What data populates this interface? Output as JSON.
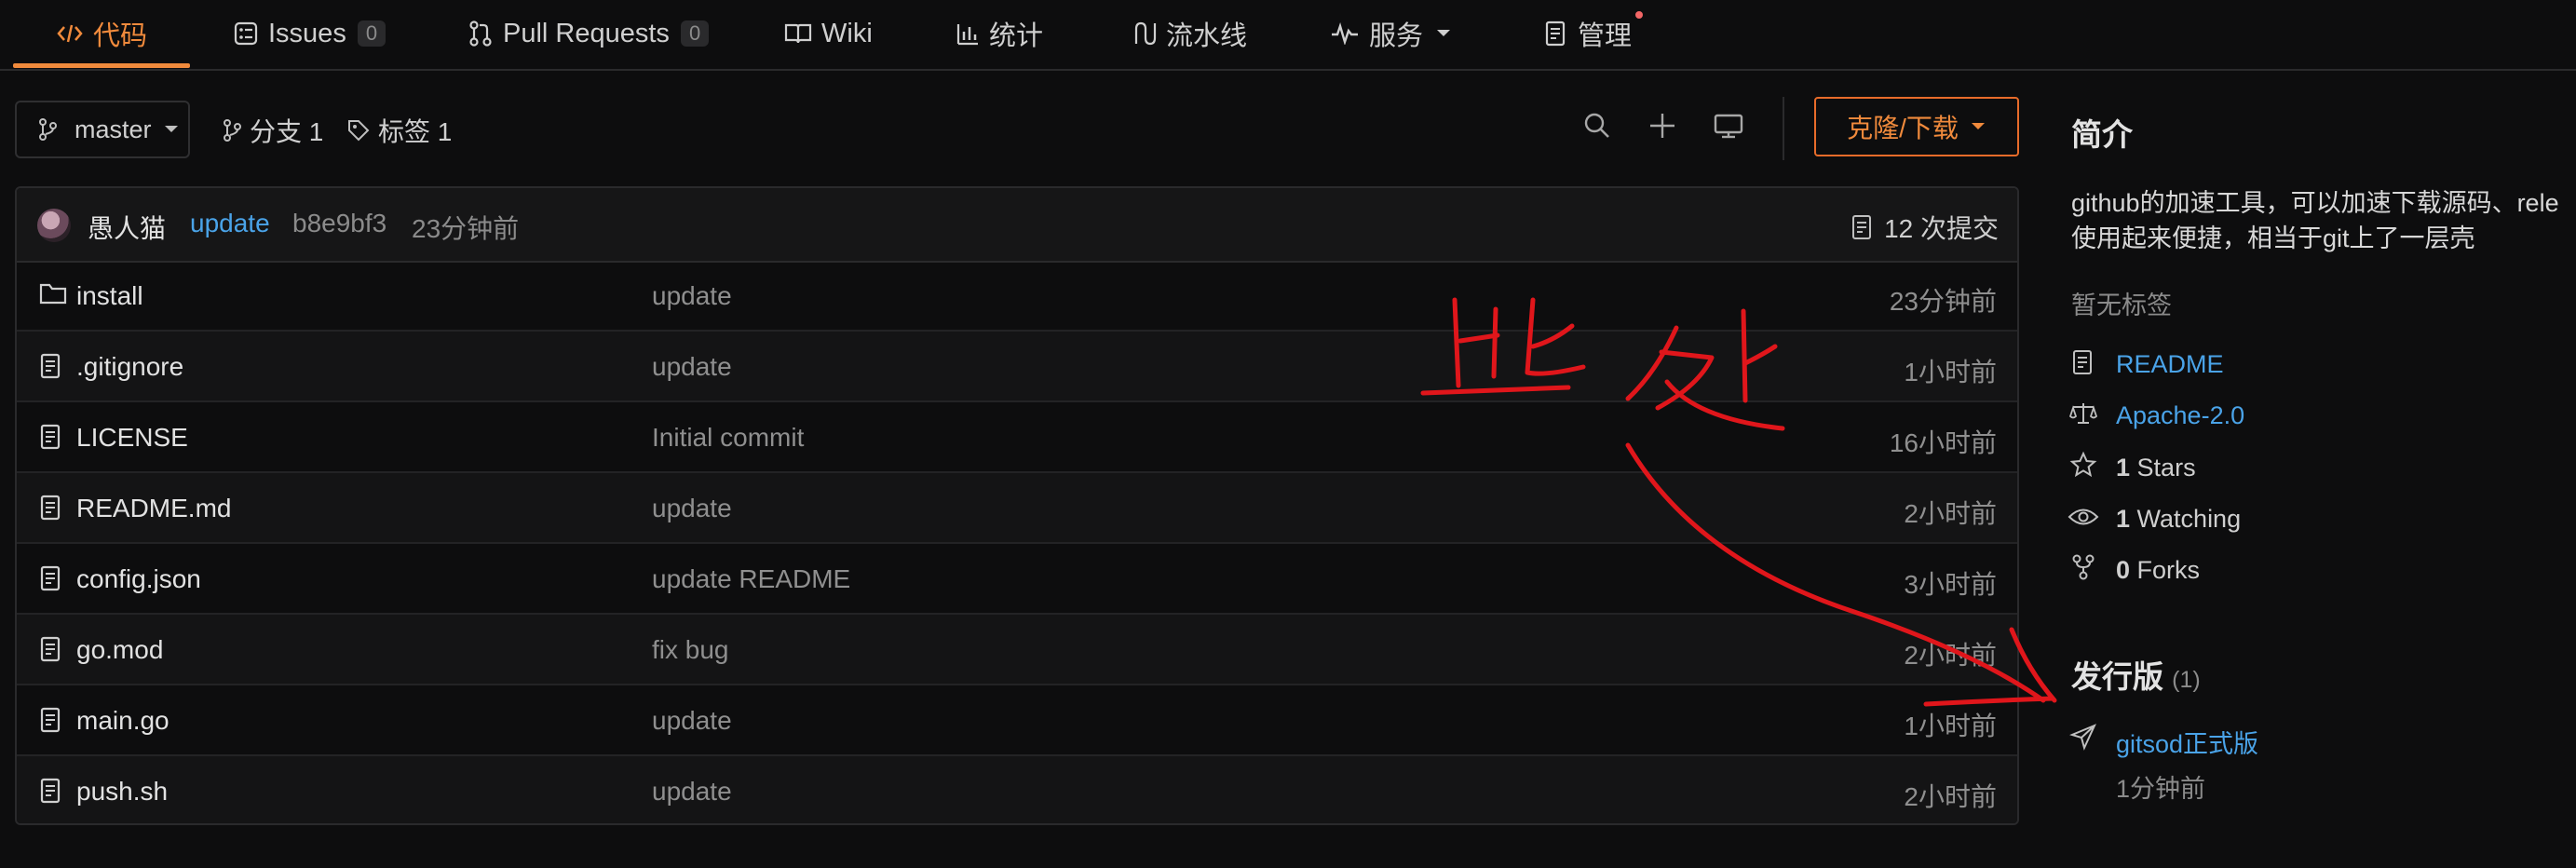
{
  "nav": {
    "tabs": [
      {
        "label": "代码",
        "icon": "code-icon",
        "active": true
      },
      {
        "label": "Issues",
        "count": "0",
        "icon": "issues-icon"
      },
      {
        "label": "Pull Requests",
        "count": "0",
        "icon": "pull-request-icon"
      },
      {
        "label": "Wiki",
        "icon": "wiki-icon"
      },
      {
        "label": "统计",
        "icon": "stats-icon"
      },
      {
        "label": "流水线",
        "icon": "pipeline-icon"
      },
      {
        "label": "服务",
        "icon": "service-icon",
        "dropdown": true
      },
      {
        "label": "管理",
        "icon": "manage-icon",
        "notify_dot": true
      }
    ],
    "accent": "#f08a3c"
  },
  "toolbar": {
    "branch": "master",
    "branches": "分支 1",
    "tags": "标签 1",
    "clone_label": "克隆/下载"
  },
  "commit": {
    "author": "愚人猫",
    "message": "update",
    "hash": "b8e9bf3",
    "time": "23分钟前",
    "count_label": "12 次提交"
  },
  "files": [
    {
      "name": "install",
      "type": "folder",
      "message": "update",
      "time": "23分钟前"
    },
    {
      "name": ".gitignore",
      "type": "file",
      "message": "update",
      "time": "1小时前"
    },
    {
      "name": "LICENSE",
      "type": "file",
      "message": "Initial commit",
      "time": "16小时前"
    },
    {
      "name": "README.md",
      "type": "file",
      "message": "update",
      "time": "2小时前"
    },
    {
      "name": "config.json",
      "type": "file",
      "message": "update README",
      "time": "3小时前"
    },
    {
      "name": "go.mod",
      "type": "file",
      "message": "fix bug",
      "time": "2小时前"
    },
    {
      "name": "main.go",
      "type": "file",
      "message": "update",
      "time": "1小时前"
    },
    {
      "name": "push.sh",
      "type": "file",
      "message": "update",
      "time": "2小时前"
    }
  ],
  "sidebar": {
    "intro_title": "简介",
    "description_line1": "github的加速工具，可以加速下载源码、rele",
    "description_line2": "使用起来便捷，相当于git上了一层壳",
    "no_tags": "暂无标签",
    "readme": "README",
    "license": "Apache-2.0",
    "stars_count": "1",
    "stars_label": "Stars",
    "watching_count": "1",
    "watching_label": "Watching",
    "forks_count": "0",
    "forks_label": "Forks",
    "releases_title": "发行版",
    "releases_count": "(1)",
    "release_name": "gitsod正式版",
    "release_time": "1分钟前"
  },
  "annotation": {
    "color": "#e0161b",
    "handwritten_text": "此处"
  }
}
